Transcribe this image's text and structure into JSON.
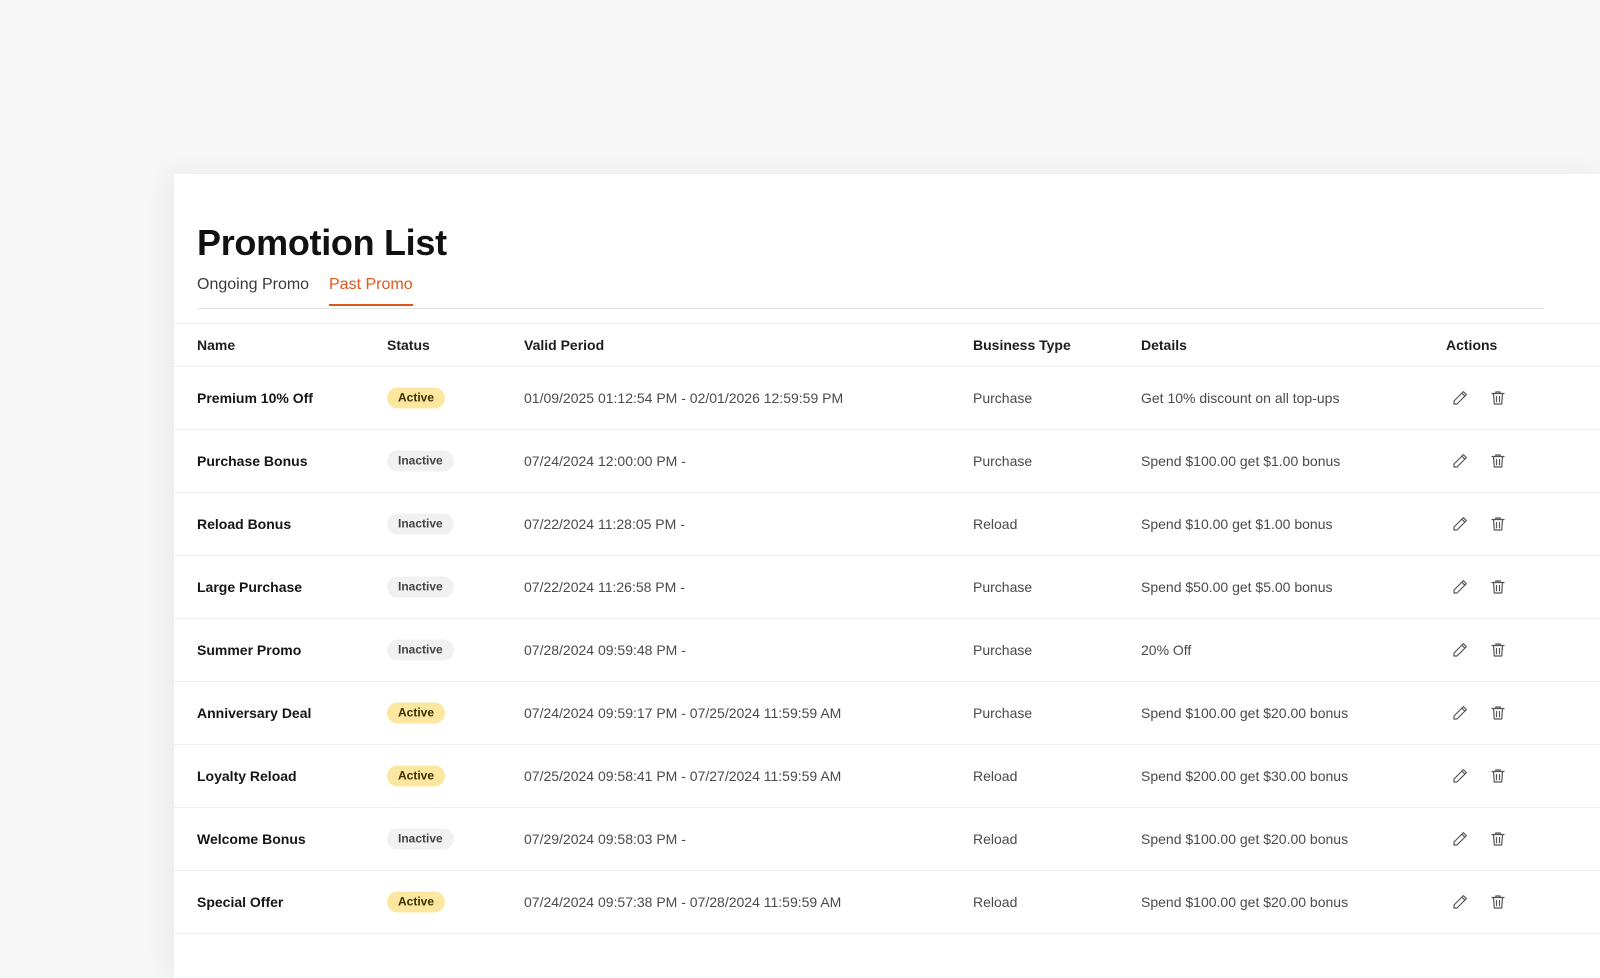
{
  "page": {
    "title": "Promotion List"
  },
  "tabs": [
    {
      "label": "Ongoing Promo",
      "active": false
    },
    {
      "label": "Past Promo",
      "active": true
    }
  ],
  "colors": {
    "accent": "#e0571a",
    "active_badge": "#fce7a0",
    "inactive_badge": "#f1f1f1"
  },
  "table": {
    "headers": {
      "name": "Name",
      "status": "Status",
      "period": "Valid Period",
      "type": "Business Type",
      "details": "Details",
      "actions": "Actions"
    },
    "rows": [
      {
        "name": "Premium 10% Off",
        "status": "Active",
        "period": "01/09/2025 01:12:54 PM - 02/01/2026 12:59:59 PM",
        "type": "Purchase",
        "details": "Get 10% discount on all top-ups"
      },
      {
        "name": "Purchase Bonus",
        "status": "Inactive",
        "period": "07/24/2024 12:00:00 PM -",
        "type": "Purchase",
        "details": "Spend $100.00 get $1.00 bonus"
      },
      {
        "name": "Reload Bonus",
        "status": "Inactive",
        "period": "07/22/2024 11:28:05 PM -",
        "type": "Reload",
        "details": "Spend $10.00 get $1.00 bonus"
      },
      {
        "name": "Large Purchase",
        "status": "Inactive",
        "period": "07/22/2024 11:26:58 PM -",
        "type": "Purchase",
        "details": "Spend $50.00 get $5.00 bonus"
      },
      {
        "name": "Summer Promo",
        "status": "Inactive",
        "period": "07/28/2024 09:59:48 PM -",
        "type": "Purchase",
        "details": "20% Off"
      },
      {
        "name": "Anniversary Deal",
        "status": "Active",
        "period": "07/24/2024 09:59:17 PM - 07/25/2024 11:59:59 AM",
        "type": "Purchase",
        "details": "Spend $100.00 get $20.00 bonus"
      },
      {
        "name": "Loyalty Reload",
        "status": "Active",
        "period": "07/25/2024 09:58:41 PM - 07/27/2024 11:59:59 AM",
        "type": "Reload",
        "details": "Spend $200.00 get $30.00 bonus"
      },
      {
        "name": "Welcome Bonus",
        "status": "Inactive",
        "period": "07/29/2024 09:58:03 PM -",
        "type": "Reload",
        "details": "Spend $100.00 get $20.00 bonus"
      },
      {
        "name": "Special Offer",
        "status": "Active",
        "period": "07/24/2024 09:57:38 PM - 07/28/2024 11:59:59 AM",
        "type": "Reload",
        "details": "Spend $100.00 get $20.00 bonus"
      }
    ]
  },
  "icons": {
    "edit": "pencil-icon",
    "delete": "trash-icon"
  }
}
